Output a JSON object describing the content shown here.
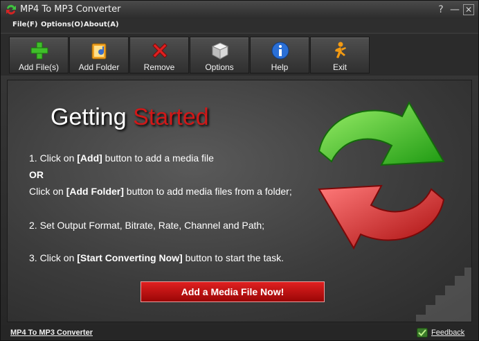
{
  "window": {
    "title": "MP4 To MP3 Converter",
    "help_glyph": "?",
    "min_glyph": "—",
    "close_glyph": "✕"
  },
  "menu": [
    {
      "label": "File(F)"
    },
    {
      "label": "Options(O)"
    },
    {
      "label": "About(A)"
    }
  ],
  "toolbar": [
    {
      "label": "Add File(s)",
      "icon": "plus-icon"
    },
    {
      "label": "Add Folder",
      "icon": "folder-icon"
    },
    {
      "label": "Remove",
      "icon": "remove-x-icon"
    },
    {
      "label": "Options",
      "icon": "cube-icon"
    },
    {
      "label": "Help",
      "icon": "info-icon"
    },
    {
      "label": "Exit",
      "icon": "running-man-icon"
    }
  ],
  "main": {
    "title_part1": "Getting",
    "title_part2": "Started",
    "step1_prefix": "1. Click on ",
    "step1_bold": "[Add]",
    "step1_suffix": " button to add a media file",
    "or_text": "OR",
    "step1b_prefix": "Click on ",
    "step1b_bold": "[Add Folder]",
    "step1b_suffix": " button to add media files from a folder;",
    "step2": "2. Set Output Format, Bitrate, Rate, Channel and Path;",
    "step3_prefix": "3. Click on ",
    "step3_bold": "[Start Converting Now]",
    "step3_suffix": " button to start the task.",
    "cta_label": "Add a Media File Now!"
  },
  "status": {
    "app_link": "MP4 To MP3 Converter",
    "feedback": "Feedback"
  },
  "colors": {
    "accent_red": "#d01818",
    "arrow_green": "#44c424",
    "arrow_red": "#d42424"
  }
}
